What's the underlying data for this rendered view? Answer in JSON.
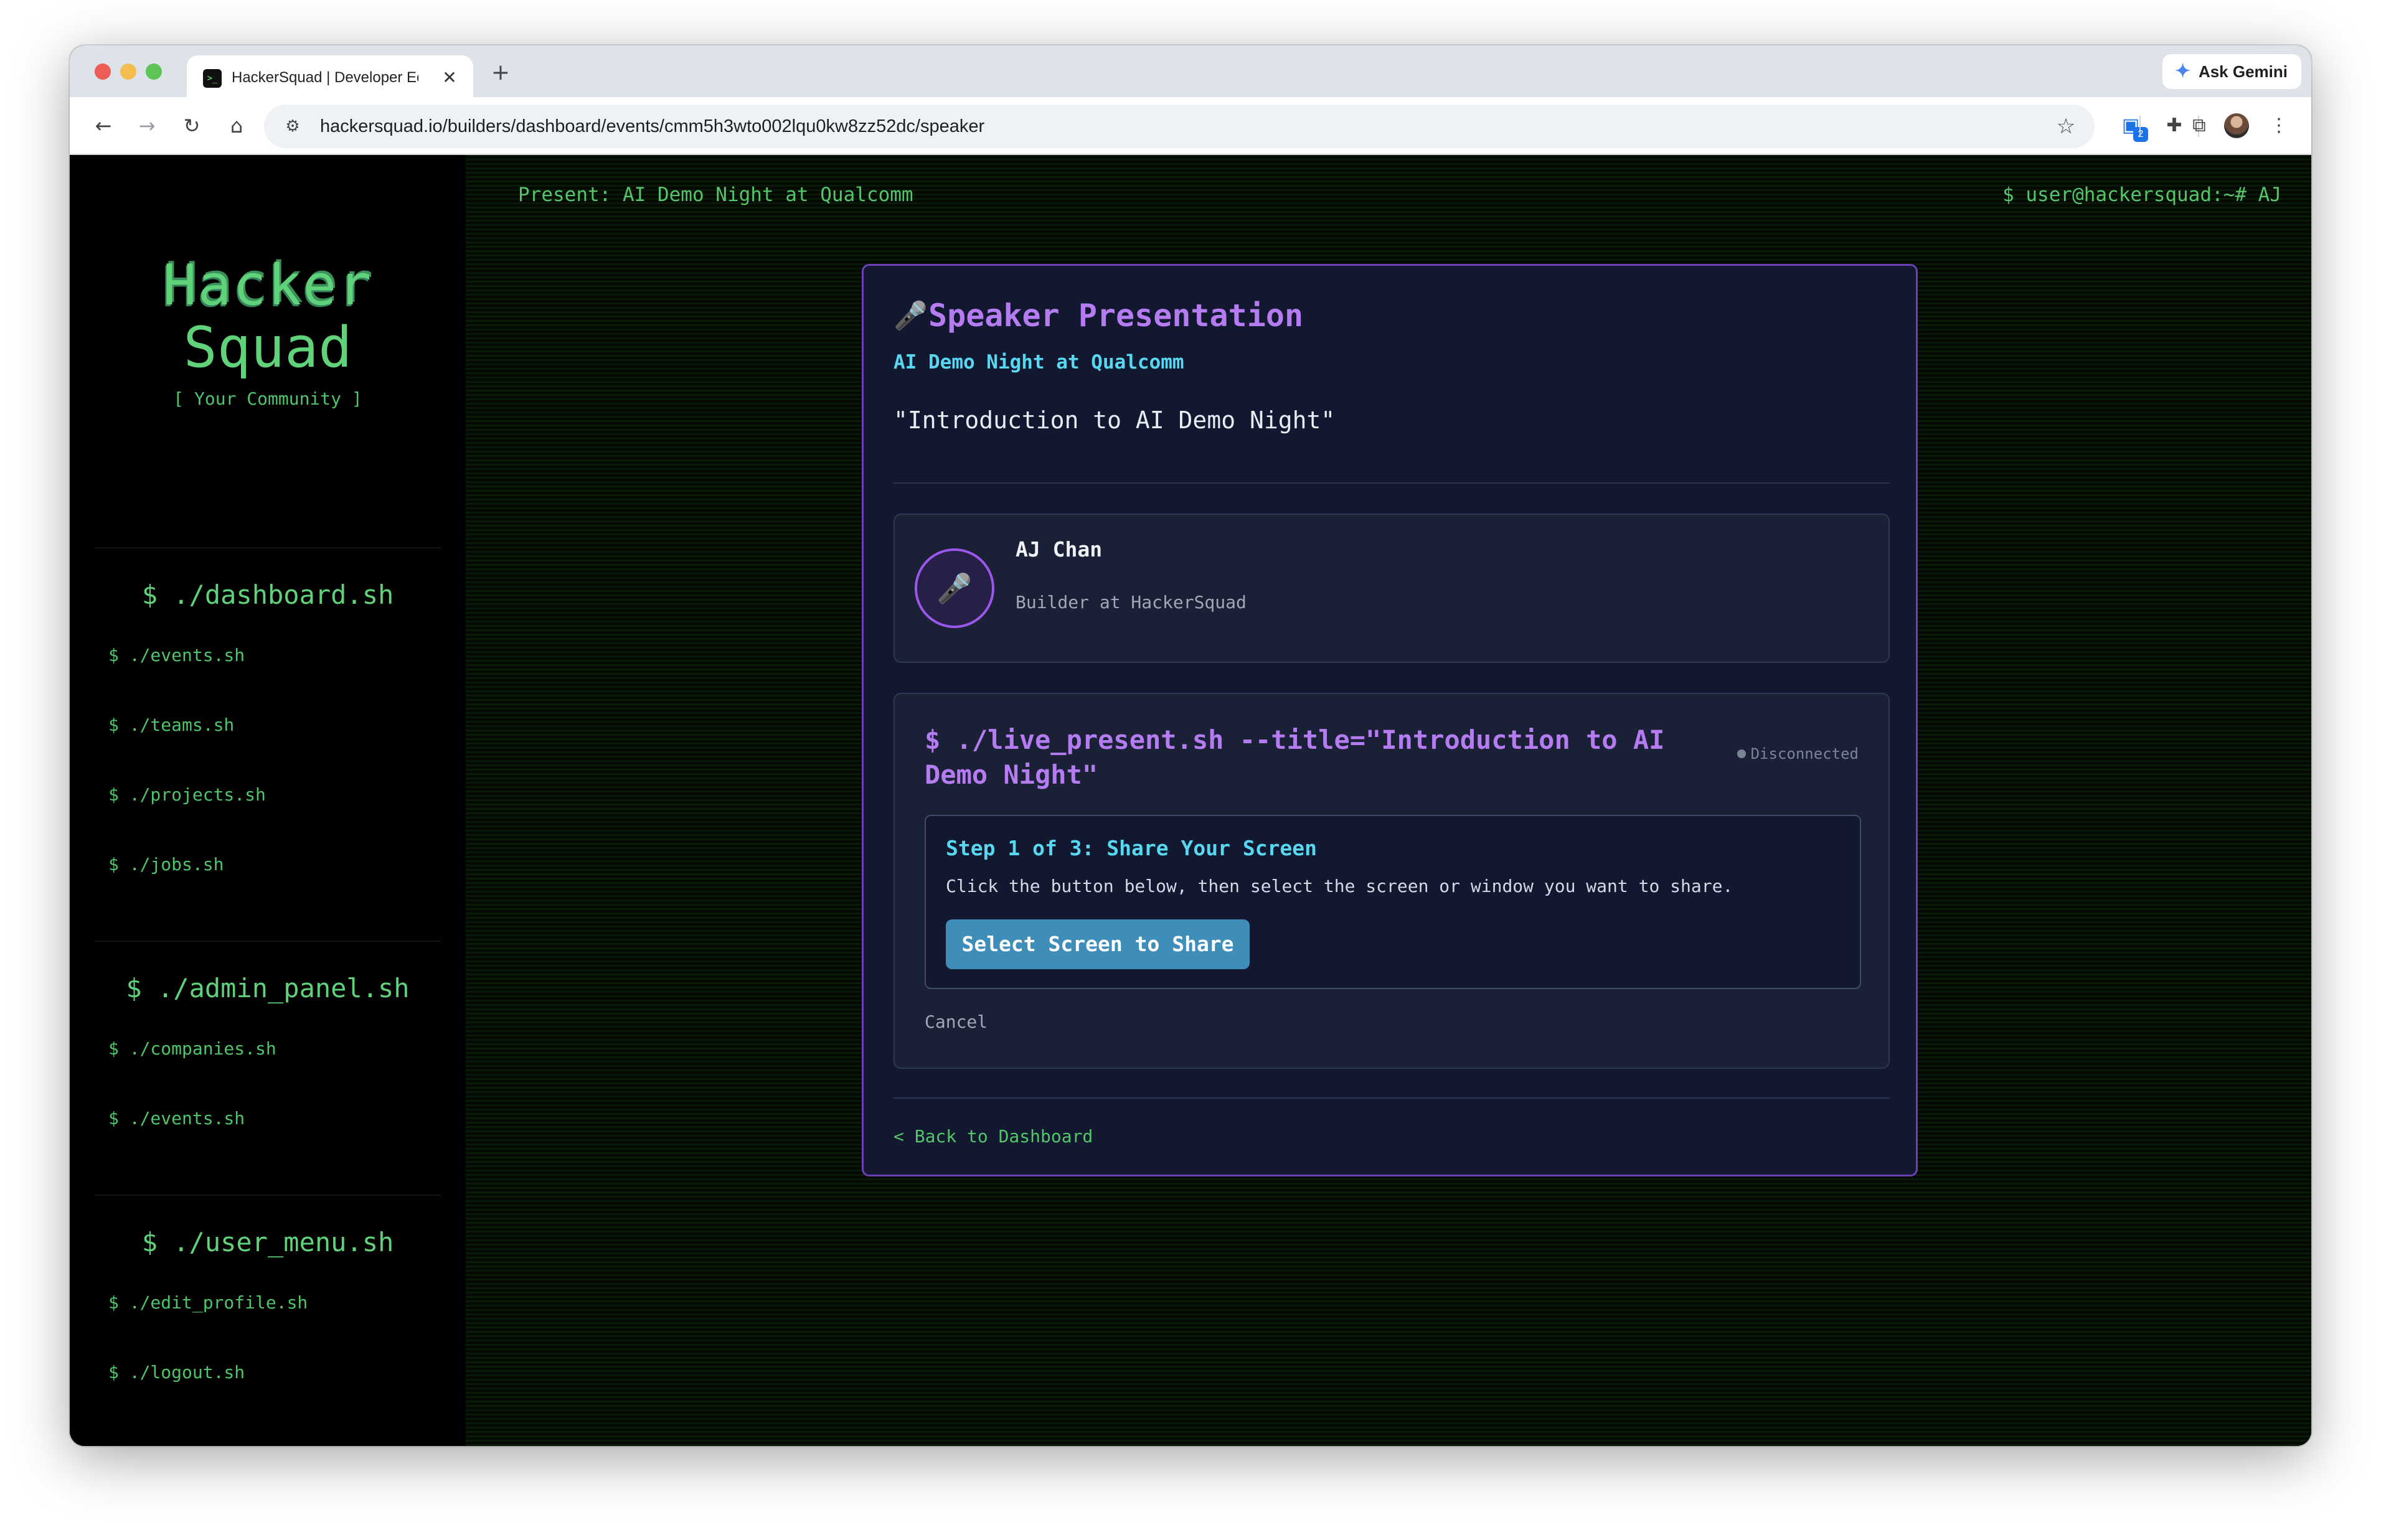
{
  "browser": {
    "tab_title": "HackerSquad | Developer Eco",
    "tab_favicon": ">_",
    "close_glyph": "✕",
    "new_tab_glyph": "+",
    "gemini_label": "Ask Gemini",
    "gemini_icon": "✦",
    "url": "hackersquad.io/builders/dashboard/events/cmm5h3wto002lqu0kw8zz52dc/speaker",
    "back_glyph": "←",
    "forward_glyph": "→",
    "reload_glyph": "↻",
    "home_glyph": "⌂",
    "tune_glyph": "⚙",
    "star_glyph": "☆",
    "extension_badge": "2",
    "extension_glyph": "▣",
    "puzzle_glyph": "✚",
    "cast_glyph": "⧉",
    "menu_glyph": "⋮"
  },
  "sidebar": {
    "brand_line1": "Hacker",
    "brand_line2": "Squad",
    "brand_tagline": "[ Your Community ]",
    "sections": [
      {
        "heading": "$ ./dashboard.sh",
        "items": [
          "$ ./events.sh",
          "$ ./teams.sh",
          "$ ./projects.sh",
          "$ ./jobs.sh"
        ]
      },
      {
        "heading": "$ ./admin_panel.sh",
        "items": [
          "$ ./companies.sh",
          "$ ./events.sh"
        ]
      },
      {
        "heading": "$ ./user_menu.sh",
        "items": [
          "$ ./edit_profile.sh",
          "$ ./logout.sh"
        ]
      }
    ]
  },
  "header": {
    "present_label": "Present: AI Demo Night at Qualcomm",
    "user_prompt": "$ user@hackersquad:~# AJ"
  },
  "card": {
    "icon": "🎤",
    "title": "Speaker Presentation",
    "event_name": "AI Demo Night at Qualcomm",
    "talk_title": "\"Introduction to AI Demo Night\"",
    "speaker": {
      "avatar_icon": "🎤",
      "name": "AJ Chan",
      "role": "Builder at HackerSquad"
    },
    "present": {
      "command": "$ ./live_present.sh --title=\"Introduction to AI Demo Night\"",
      "status": "Disconnected",
      "step_title": "Step 1 of 3: Share Your Screen",
      "step_desc": "Click the button below, then select the screen or window you want to share.",
      "select_button": "Select Screen to Share",
      "cancel": "Cancel"
    },
    "back_link": "< Back to Dashboard"
  }
}
